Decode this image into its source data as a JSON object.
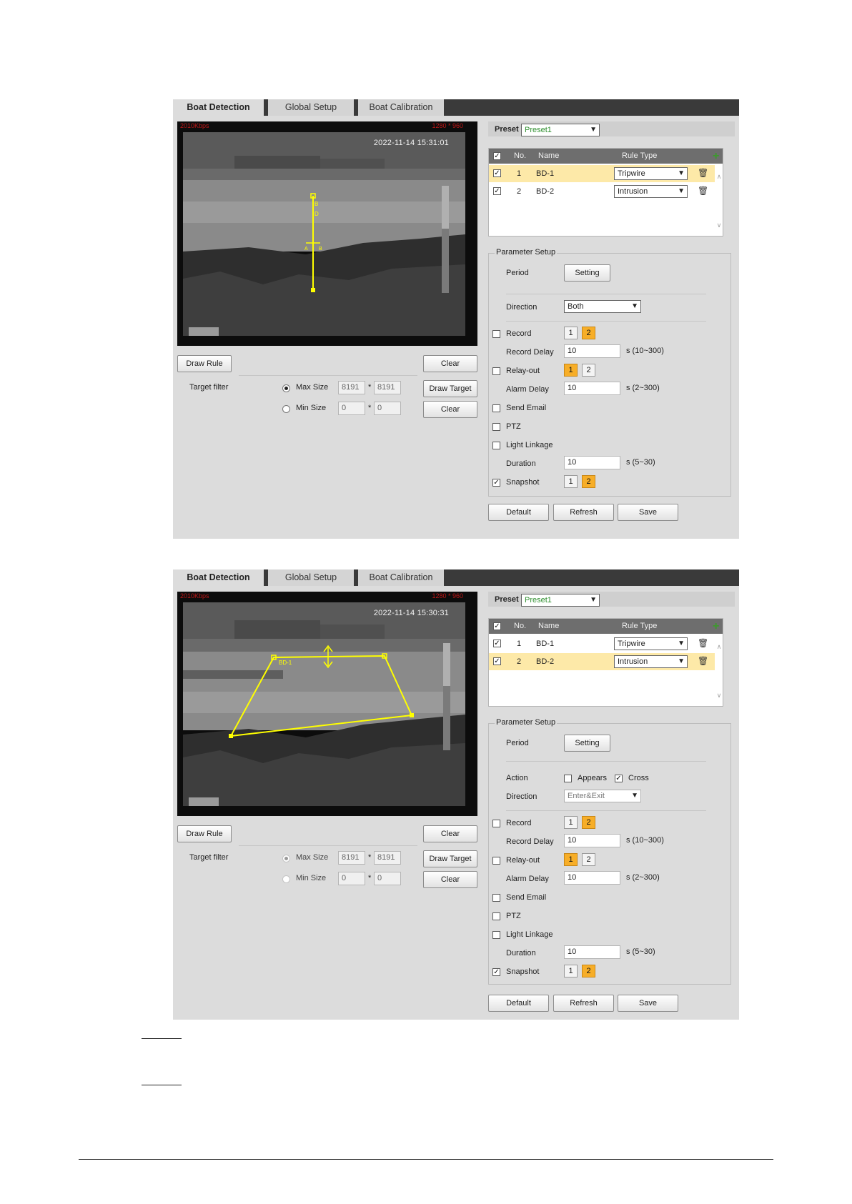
{
  "tabs": [
    "Boat Detection",
    "Global Setup",
    "Boat Calibration"
  ],
  "labels": {
    "preset": "Preset",
    "parameter_setup": "Parameter Setup",
    "period": "Period",
    "direction": "Direction",
    "action": "Action",
    "record": "Record",
    "record_delay": "Record Delay",
    "relay_out": "Relay-out",
    "alarm_delay": "Alarm Delay",
    "send_email": "Send Email",
    "ptz": "PTZ",
    "light_linkage": "Light Linkage",
    "duration": "Duration",
    "snapshot": "Snapshot",
    "target_filter": "Target filter",
    "max_size": "Max Size",
    "min_size": "Min Size",
    "times": "*",
    "appears": "Appears",
    "cross": "Cross",
    "range_record": "s (10~300)",
    "range_alarm": "s (2~300)",
    "range_duration": "s (5~30)"
  },
  "buttons": {
    "draw_rule": "Draw Rule",
    "clear": "Clear",
    "draw_target": "Draw Target",
    "setting": "Setting",
    "default": "Default",
    "refresh": "Refresh",
    "save": "Save"
  },
  "table": {
    "headers": [
      "No.",
      "Name",
      "Rule Type"
    ],
    "rows": [
      {
        "no": "1",
        "name": "BD-1",
        "type": "Tripwire"
      },
      {
        "no": "2",
        "name": "BD-2",
        "type": "Intrusion"
      }
    ]
  },
  "icons": {
    "add": "plus-icon",
    "delete": "trash-icon",
    "check": "checkmark-icon"
  },
  "colors": {
    "highlight_row": "#fde9a8",
    "active_number": "#f7ae28",
    "rule_line": "#ffff00",
    "preset_text": "#2f8f2f"
  },
  "panel1": {
    "video": {
      "bitrate": "2010Kbps",
      "resolution": "1280 * 960",
      "timestamp": "2022-11-14 15:31:01",
      "rule_label": "BD-1"
    },
    "preset": "Preset1",
    "selected_row": 1,
    "direction": "Both",
    "record_delay": "10",
    "alarm_delay": "10",
    "duration": "10",
    "max_w": "8191",
    "max_h": "8191",
    "min_w": "0",
    "min_h": "0",
    "record_channels": [
      "1",
      "2"
    ],
    "record_active": "2",
    "relay_channels": [
      "1",
      "2"
    ],
    "relay_active": "1",
    "snapshot_channels": [
      "1",
      "2"
    ],
    "snapshot_active": "2"
  },
  "panel2": {
    "video": {
      "bitrate": "2010Kbps",
      "resolution": "1280 * 960",
      "timestamp": "2022-11-14 15:30:31",
      "rule_label": "BD-1"
    },
    "preset": "Preset1",
    "selected_row": 2,
    "direction": "Enter&Exit",
    "record_delay": "10",
    "alarm_delay": "10",
    "duration": "10",
    "max_w": "8191",
    "max_h": "8191",
    "min_w": "0",
    "min_h": "0",
    "record_channels": [
      "1",
      "2"
    ],
    "record_active": "2",
    "relay_channels": [
      "1",
      "2"
    ],
    "relay_active": "1",
    "snapshot_channels": [
      "1",
      "2"
    ],
    "snapshot_active": "2"
  }
}
